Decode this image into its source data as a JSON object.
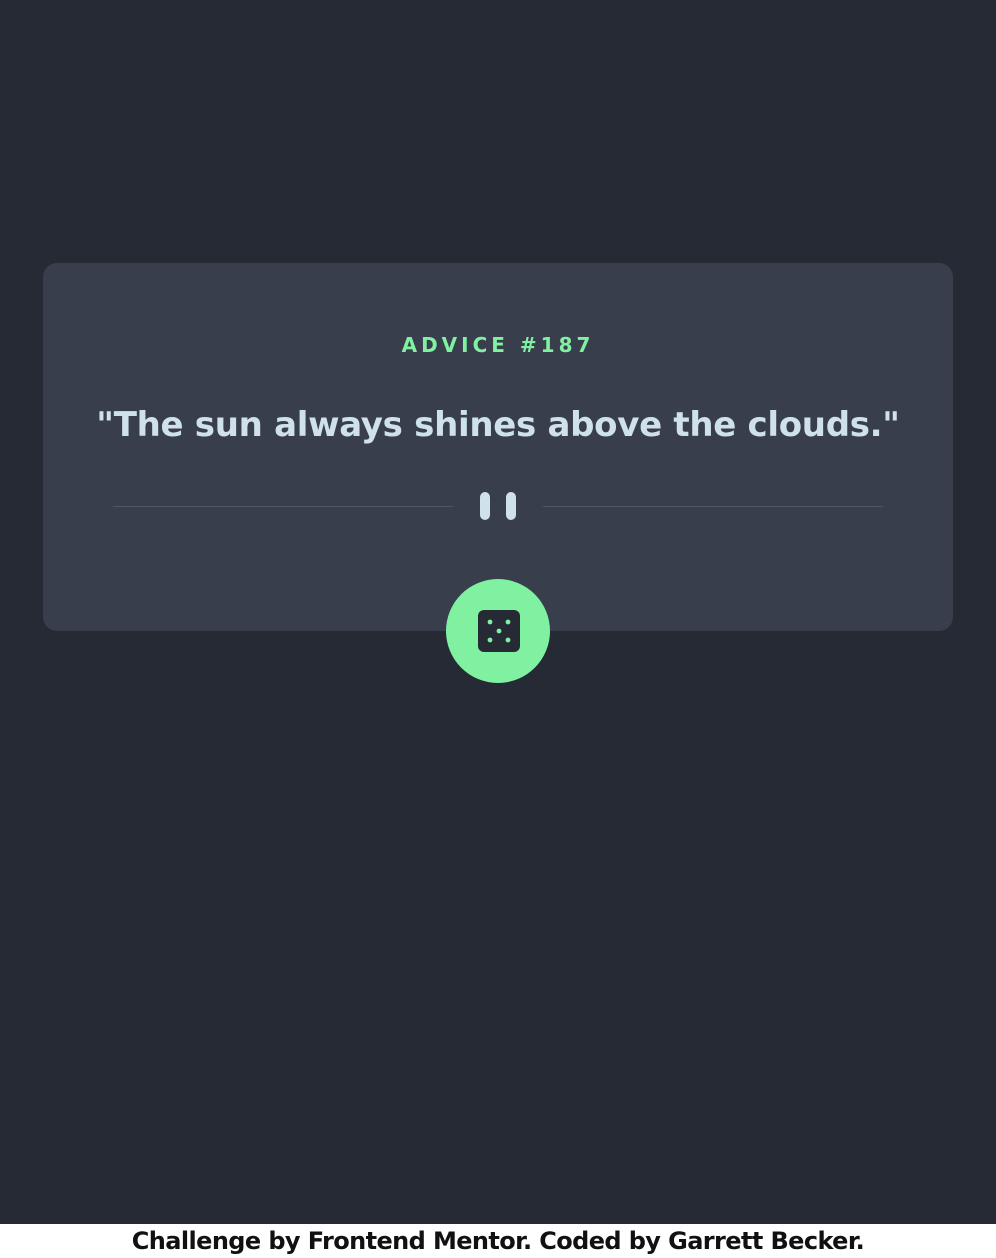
{
  "card": {
    "advice_label": "ADVICE #187",
    "advice_text": "\"The sun always shines above the clouds.\""
  },
  "icons": {
    "divider": "pause-icon",
    "button": "dice-icon"
  },
  "colors": {
    "background": "#262a35",
    "card": "#393e4c",
    "accent": "#7ff1a0",
    "text": "#cfe2ec",
    "footer_bg": "#ffffff"
  },
  "footer": {
    "text": "Challenge by Frontend Mentor. Coded by Garrett Becker."
  }
}
